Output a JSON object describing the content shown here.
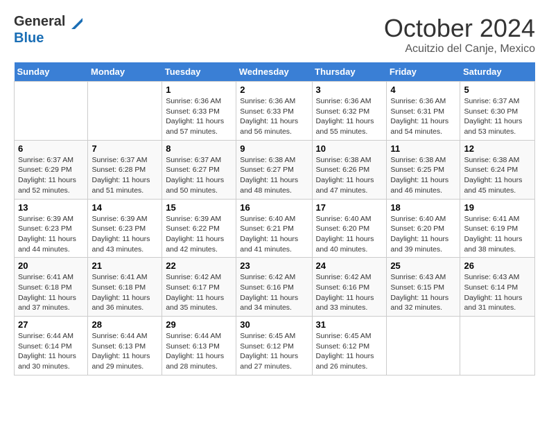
{
  "header": {
    "logo_line1": "General",
    "logo_line2": "Blue",
    "month": "October 2024",
    "location": "Acuitzio del Canje, Mexico"
  },
  "weekdays": [
    "Sunday",
    "Monday",
    "Tuesday",
    "Wednesday",
    "Thursday",
    "Friday",
    "Saturday"
  ],
  "weeks": [
    [
      null,
      null,
      {
        "day": 1,
        "sunrise": "6:36 AM",
        "sunset": "6:33 PM",
        "daylight": "11 hours and 57 minutes."
      },
      {
        "day": 2,
        "sunrise": "6:36 AM",
        "sunset": "6:33 PM",
        "daylight": "11 hours and 56 minutes."
      },
      {
        "day": 3,
        "sunrise": "6:36 AM",
        "sunset": "6:32 PM",
        "daylight": "11 hours and 55 minutes."
      },
      {
        "day": 4,
        "sunrise": "6:36 AM",
        "sunset": "6:31 PM",
        "daylight": "11 hours and 54 minutes."
      },
      {
        "day": 5,
        "sunrise": "6:37 AM",
        "sunset": "6:30 PM",
        "daylight": "11 hours and 53 minutes."
      }
    ],
    [
      {
        "day": 6,
        "sunrise": "6:37 AM",
        "sunset": "6:29 PM",
        "daylight": "11 hours and 52 minutes."
      },
      {
        "day": 7,
        "sunrise": "6:37 AM",
        "sunset": "6:28 PM",
        "daylight": "11 hours and 51 minutes."
      },
      {
        "day": 8,
        "sunrise": "6:37 AM",
        "sunset": "6:27 PM",
        "daylight": "11 hours and 50 minutes."
      },
      {
        "day": 9,
        "sunrise": "6:38 AM",
        "sunset": "6:27 PM",
        "daylight": "11 hours and 48 minutes."
      },
      {
        "day": 10,
        "sunrise": "6:38 AM",
        "sunset": "6:26 PM",
        "daylight": "11 hours and 47 minutes."
      },
      {
        "day": 11,
        "sunrise": "6:38 AM",
        "sunset": "6:25 PM",
        "daylight": "11 hours and 46 minutes."
      },
      {
        "day": 12,
        "sunrise": "6:38 AM",
        "sunset": "6:24 PM",
        "daylight": "11 hours and 45 minutes."
      }
    ],
    [
      {
        "day": 13,
        "sunrise": "6:39 AM",
        "sunset": "6:23 PM",
        "daylight": "11 hours and 44 minutes."
      },
      {
        "day": 14,
        "sunrise": "6:39 AM",
        "sunset": "6:23 PM",
        "daylight": "11 hours and 43 minutes."
      },
      {
        "day": 15,
        "sunrise": "6:39 AM",
        "sunset": "6:22 PM",
        "daylight": "11 hours and 42 minutes."
      },
      {
        "day": 16,
        "sunrise": "6:40 AM",
        "sunset": "6:21 PM",
        "daylight": "11 hours and 41 minutes."
      },
      {
        "day": 17,
        "sunrise": "6:40 AM",
        "sunset": "6:20 PM",
        "daylight": "11 hours and 40 minutes."
      },
      {
        "day": 18,
        "sunrise": "6:40 AM",
        "sunset": "6:20 PM",
        "daylight": "11 hours and 39 minutes."
      },
      {
        "day": 19,
        "sunrise": "6:41 AM",
        "sunset": "6:19 PM",
        "daylight": "11 hours and 38 minutes."
      }
    ],
    [
      {
        "day": 20,
        "sunrise": "6:41 AM",
        "sunset": "6:18 PM",
        "daylight": "11 hours and 37 minutes."
      },
      {
        "day": 21,
        "sunrise": "6:41 AM",
        "sunset": "6:18 PM",
        "daylight": "11 hours and 36 minutes."
      },
      {
        "day": 22,
        "sunrise": "6:42 AM",
        "sunset": "6:17 PM",
        "daylight": "11 hours and 35 minutes."
      },
      {
        "day": 23,
        "sunrise": "6:42 AM",
        "sunset": "6:16 PM",
        "daylight": "11 hours and 34 minutes."
      },
      {
        "day": 24,
        "sunrise": "6:42 AM",
        "sunset": "6:16 PM",
        "daylight": "11 hours and 33 minutes."
      },
      {
        "day": 25,
        "sunrise": "6:43 AM",
        "sunset": "6:15 PM",
        "daylight": "11 hours and 32 minutes."
      },
      {
        "day": 26,
        "sunrise": "6:43 AM",
        "sunset": "6:14 PM",
        "daylight": "11 hours and 31 minutes."
      }
    ],
    [
      {
        "day": 27,
        "sunrise": "6:44 AM",
        "sunset": "6:14 PM",
        "daylight": "11 hours and 30 minutes."
      },
      {
        "day": 28,
        "sunrise": "6:44 AM",
        "sunset": "6:13 PM",
        "daylight": "11 hours and 29 minutes."
      },
      {
        "day": 29,
        "sunrise": "6:44 AM",
        "sunset": "6:13 PM",
        "daylight": "11 hours and 28 minutes."
      },
      {
        "day": 30,
        "sunrise": "6:45 AM",
        "sunset": "6:12 PM",
        "daylight": "11 hours and 27 minutes."
      },
      {
        "day": 31,
        "sunrise": "6:45 AM",
        "sunset": "6:12 PM",
        "daylight": "11 hours and 26 minutes."
      },
      null,
      null
    ]
  ]
}
